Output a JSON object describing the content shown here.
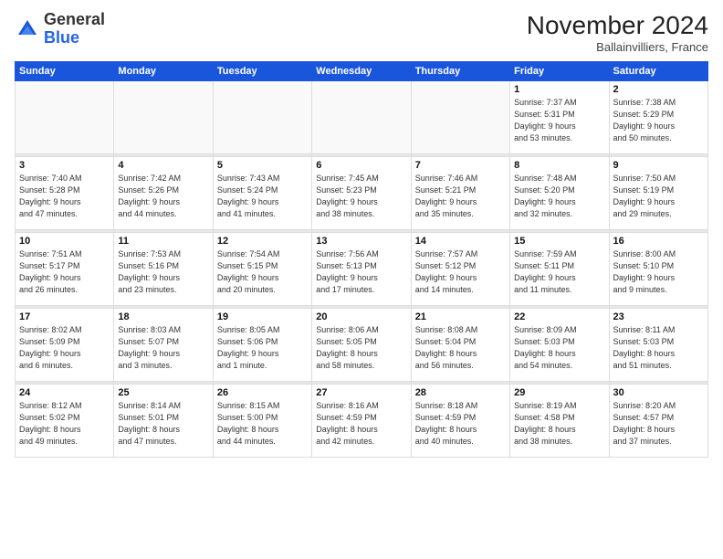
{
  "header": {
    "logo_general": "General",
    "logo_blue": "Blue",
    "month_title": "November 2024",
    "location": "Ballainvilliers, France"
  },
  "weekdays": [
    "Sunday",
    "Monday",
    "Tuesday",
    "Wednesday",
    "Thursday",
    "Friday",
    "Saturday"
  ],
  "weeks": [
    [
      {
        "day": "",
        "info": ""
      },
      {
        "day": "",
        "info": ""
      },
      {
        "day": "",
        "info": ""
      },
      {
        "day": "",
        "info": ""
      },
      {
        "day": "",
        "info": ""
      },
      {
        "day": "1",
        "info": "Sunrise: 7:37 AM\nSunset: 5:31 PM\nDaylight: 9 hours\nand 53 minutes."
      },
      {
        "day": "2",
        "info": "Sunrise: 7:38 AM\nSunset: 5:29 PM\nDaylight: 9 hours\nand 50 minutes."
      }
    ],
    [
      {
        "day": "3",
        "info": "Sunrise: 7:40 AM\nSunset: 5:28 PM\nDaylight: 9 hours\nand 47 minutes."
      },
      {
        "day": "4",
        "info": "Sunrise: 7:42 AM\nSunset: 5:26 PM\nDaylight: 9 hours\nand 44 minutes."
      },
      {
        "day": "5",
        "info": "Sunrise: 7:43 AM\nSunset: 5:24 PM\nDaylight: 9 hours\nand 41 minutes."
      },
      {
        "day": "6",
        "info": "Sunrise: 7:45 AM\nSunset: 5:23 PM\nDaylight: 9 hours\nand 38 minutes."
      },
      {
        "day": "7",
        "info": "Sunrise: 7:46 AM\nSunset: 5:21 PM\nDaylight: 9 hours\nand 35 minutes."
      },
      {
        "day": "8",
        "info": "Sunrise: 7:48 AM\nSunset: 5:20 PM\nDaylight: 9 hours\nand 32 minutes."
      },
      {
        "day": "9",
        "info": "Sunrise: 7:50 AM\nSunset: 5:19 PM\nDaylight: 9 hours\nand 29 minutes."
      }
    ],
    [
      {
        "day": "10",
        "info": "Sunrise: 7:51 AM\nSunset: 5:17 PM\nDaylight: 9 hours\nand 26 minutes."
      },
      {
        "day": "11",
        "info": "Sunrise: 7:53 AM\nSunset: 5:16 PM\nDaylight: 9 hours\nand 23 minutes."
      },
      {
        "day": "12",
        "info": "Sunrise: 7:54 AM\nSunset: 5:15 PM\nDaylight: 9 hours\nand 20 minutes."
      },
      {
        "day": "13",
        "info": "Sunrise: 7:56 AM\nSunset: 5:13 PM\nDaylight: 9 hours\nand 17 minutes."
      },
      {
        "day": "14",
        "info": "Sunrise: 7:57 AM\nSunset: 5:12 PM\nDaylight: 9 hours\nand 14 minutes."
      },
      {
        "day": "15",
        "info": "Sunrise: 7:59 AM\nSunset: 5:11 PM\nDaylight: 9 hours\nand 11 minutes."
      },
      {
        "day": "16",
        "info": "Sunrise: 8:00 AM\nSunset: 5:10 PM\nDaylight: 9 hours\nand 9 minutes."
      }
    ],
    [
      {
        "day": "17",
        "info": "Sunrise: 8:02 AM\nSunset: 5:09 PM\nDaylight: 9 hours\nand 6 minutes."
      },
      {
        "day": "18",
        "info": "Sunrise: 8:03 AM\nSunset: 5:07 PM\nDaylight: 9 hours\nand 3 minutes."
      },
      {
        "day": "19",
        "info": "Sunrise: 8:05 AM\nSunset: 5:06 PM\nDaylight: 9 hours\nand 1 minute."
      },
      {
        "day": "20",
        "info": "Sunrise: 8:06 AM\nSunset: 5:05 PM\nDaylight: 8 hours\nand 58 minutes."
      },
      {
        "day": "21",
        "info": "Sunrise: 8:08 AM\nSunset: 5:04 PM\nDaylight: 8 hours\nand 56 minutes."
      },
      {
        "day": "22",
        "info": "Sunrise: 8:09 AM\nSunset: 5:03 PM\nDaylight: 8 hours\nand 54 minutes."
      },
      {
        "day": "23",
        "info": "Sunrise: 8:11 AM\nSunset: 5:03 PM\nDaylight: 8 hours\nand 51 minutes."
      }
    ],
    [
      {
        "day": "24",
        "info": "Sunrise: 8:12 AM\nSunset: 5:02 PM\nDaylight: 8 hours\nand 49 minutes."
      },
      {
        "day": "25",
        "info": "Sunrise: 8:14 AM\nSunset: 5:01 PM\nDaylight: 8 hours\nand 47 minutes."
      },
      {
        "day": "26",
        "info": "Sunrise: 8:15 AM\nSunset: 5:00 PM\nDaylight: 8 hours\nand 44 minutes."
      },
      {
        "day": "27",
        "info": "Sunrise: 8:16 AM\nSunset: 4:59 PM\nDaylight: 8 hours\nand 42 minutes."
      },
      {
        "day": "28",
        "info": "Sunrise: 8:18 AM\nSunset: 4:59 PM\nDaylight: 8 hours\nand 40 minutes."
      },
      {
        "day": "29",
        "info": "Sunrise: 8:19 AM\nSunset: 4:58 PM\nDaylight: 8 hours\nand 38 minutes."
      },
      {
        "day": "30",
        "info": "Sunrise: 8:20 AM\nSunset: 4:57 PM\nDaylight: 8 hours\nand 37 minutes."
      }
    ]
  ]
}
